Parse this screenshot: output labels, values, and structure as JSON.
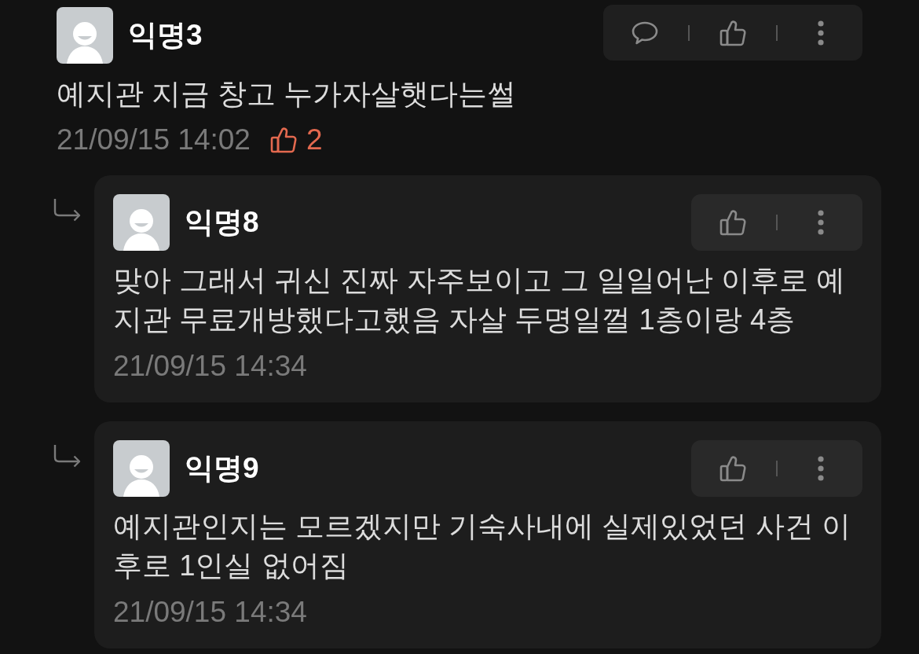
{
  "comment": {
    "author": "익명3",
    "actions": [
      {
        "kind": "comment"
      },
      {
        "kind": "like"
      },
      {
        "kind": "more"
      }
    ],
    "text": "예지관 지금 창고 누가자살햇다는썰",
    "time": "21/09/15 14:02",
    "likes": "2"
  },
  "replies": [
    {
      "author": "익명8",
      "actions": [
        {
          "kind": "like"
        },
        {
          "kind": "more"
        }
      ],
      "text": "맞아 그래서 귀신 진짜 자주보이고 그 일일어난 이후로 예지관 무료개방했다고했음 자살 두명일껄 1층이랑 4층",
      "time": "21/09/15 14:34"
    },
    {
      "author": "익명9",
      "actions": [
        {
          "kind": "like"
        },
        {
          "kind": "more"
        }
      ],
      "text": "예지관인지는 모르겠지만 기숙사내에 실제있었던 사건 이후로 1인실 없어짐",
      "time": "21/09/15 14:34"
    }
  ]
}
